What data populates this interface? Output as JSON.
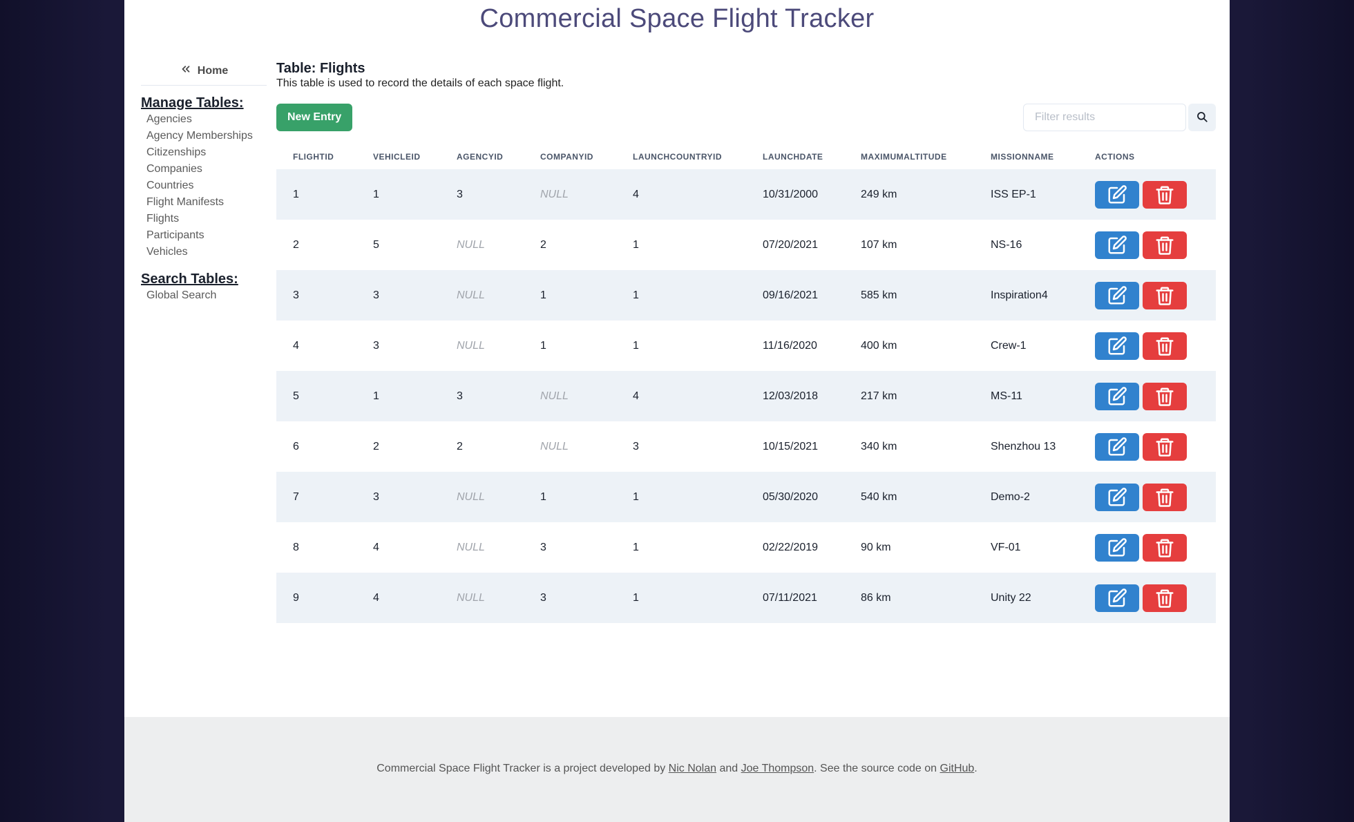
{
  "app": {
    "title": "Commercial Space Flight Tracker"
  },
  "sidebar": {
    "home_label": "Home",
    "manage_title": "Manage Tables:",
    "manage_items": [
      {
        "label": "Agencies"
      },
      {
        "label": "Agency Memberships"
      },
      {
        "label": "Citizenships"
      },
      {
        "label": "Companies"
      },
      {
        "label": "Countries"
      },
      {
        "label": "Flight Manifests"
      },
      {
        "label": "Flights"
      },
      {
        "label": "Participants"
      },
      {
        "label": "Vehicles"
      }
    ],
    "search_title": "Search Tables:",
    "search_items": [
      {
        "label": "Global Search"
      }
    ]
  },
  "main": {
    "heading": "Table: Flights",
    "description": "This table is used to record the details of each space flight.",
    "new_entry_label": "New Entry",
    "filter_placeholder": "Filter results",
    "columns": [
      "FLIGHTID",
      "VEHICLEID",
      "AGENCYID",
      "COMPANYID",
      "LAUNCHCOUNTRYID",
      "LAUNCHDATE",
      "MAXIMUMALTITUDE",
      "MISSIONNAME",
      "ACTIONS"
    ],
    "rows": [
      [
        "1",
        "1",
        "3",
        "NULL",
        "4",
        "10/31/2000",
        "249 km",
        "ISS EP-1"
      ],
      [
        "2",
        "5",
        "NULL",
        "2",
        "1",
        "07/20/2021",
        "107 km",
        "NS-16"
      ],
      [
        "3",
        "3",
        "NULL",
        "1",
        "1",
        "09/16/2021",
        "585 km",
        "Inspiration4"
      ],
      [
        "4",
        "3",
        "NULL",
        "1",
        "1",
        "11/16/2020",
        "400 km",
        "Crew-1"
      ],
      [
        "5",
        "1",
        "3",
        "NULL",
        "4",
        "12/03/2018",
        "217 km",
        "MS-11"
      ],
      [
        "6",
        "2",
        "2",
        "NULL",
        "3",
        "10/15/2021",
        "340 km",
        "Shenzhou 13"
      ],
      [
        "7",
        "3",
        "NULL",
        "1",
        "1",
        "05/30/2020",
        "540 km",
        "Demo-2"
      ],
      [
        "8",
        "4",
        "NULL",
        "3",
        "1",
        "02/22/2019",
        "90 km",
        "VF-01"
      ],
      [
        "9",
        "4",
        "NULL",
        "3",
        "1",
        "07/11/2021",
        "86 km",
        "Unity 22"
      ]
    ]
  },
  "footer": {
    "text_1": "Commercial Space Flight Tracker is a project developed by ",
    "author_1": "Nic Nolan",
    "text_2": " and ",
    "author_2": "Joe Thompson",
    "text_3": ". See the source code on ",
    "repo_link": "GitHub",
    "text_4": "."
  },
  "colors": {
    "new_entry": "#38a169",
    "edit": "#3182ce",
    "delete": "#e53e3e",
    "title": "#4c4a7a",
    "stripe": "#edf2f7"
  },
  "icons": {
    "home": "double-chevron-left-icon",
    "search": "search-icon",
    "edit": "edit-icon",
    "delete": "trash-icon"
  }
}
